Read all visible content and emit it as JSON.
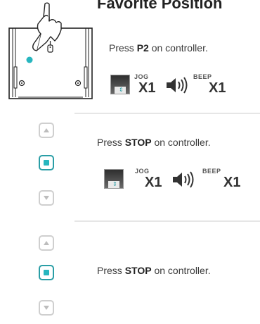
{
  "header": {
    "title": "Favorite Position"
  },
  "steps": [
    {
      "prefix": "Press ",
      "key": "P2",
      "suffix": " on controller.",
      "jog": {
        "label": "JOG",
        "count": "X1"
      },
      "beep": {
        "label": "BEEP",
        "count": "X1"
      }
    },
    {
      "prefix": "Press ",
      "key": "STOP",
      "suffix": " on controller.",
      "jog": {
        "label": "JOG",
        "count": "X1"
      },
      "beep": {
        "label": "BEEP",
        "count": "X1"
      }
    },
    {
      "prefix": "Press ",
      "key": "STOP",
      "suffix": " on controller."
    }
  ],
  "colors": {
    "accent": "#27b6bf",
    "accent_border": "#2a9ea6",
    "button_border": "#cfcfcf",
    "divider": "#e6e6e6"
  },
  "icons": [
    "hand-pointer-icon",
    "motor-head-device-icon",
    "up-arrow-icon",
    "stop-square-icon",
    "down-arrow-icon",
    "jog-shade-icon",
    "speaker-icon"
  ]
}
